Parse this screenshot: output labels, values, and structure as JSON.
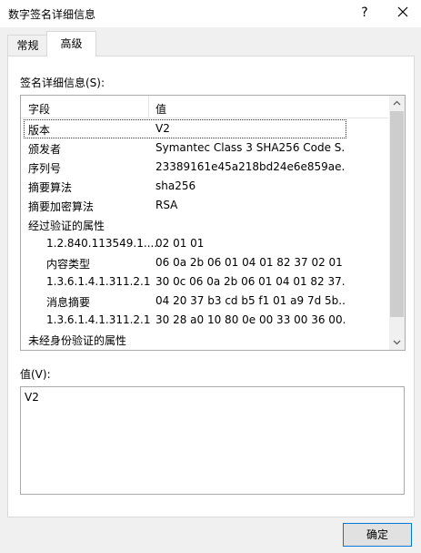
{
  "window": {
    "title": "数字签名详细信息",
    "help_label": "?"
  },
  "tabs": [
    {
      "label": "常规",
      "active": false
    },
    {
      "label": "高级",
      "active": true
    }
  ],
  "signature_details": {
    "label": "签名详细信息(S):",
    "columns": {
      "field": "字段",
      "value": "值"
    },
    "rows": [
      {
        "field": "版本",
        "value": "V2",
        "indent": 0,
        "selected": true
      },
      {
        "field": "颁发者",
        "value": "Symantec Class 3 SHA256 Code S...",
        "indent": 0
      },
      {
        "field": "序列号",
        "value": "23389161e45a218bd24e6e859ae...",
        "indent": 0
      },
      {
        "field": "摘要算法",
        "value": "sha256",
        "indent": 0
      },
      {
        "field": "摘要加密算法",
        "value": "RSA",
        "indent": 0
      },
      {
        "field": "经过验证的属性",
        "value": "",
        "indent": 0
      },
      {
        "field": "1.2.840.113549.1....",
        "value": "02 01 01",
        "indent": 1
      },
      {
        "field": "内容类型",
        "value": "06 0a 2b 06 01 04 01 82 37 02 01",
        "indent": 1
      },
      {
        "field": "1.3.6.1.4.1.311.2.1",
        "value": "30 0c 06 0a 2b 06 01 04 01 82 37...",
        "indent": 1
      },
      {
        "field": "消息摘要",
        "value": "04 20 37 b3 cd b5 f1 01 a9 7d 5b...",
        "indent": 1
      },
      {
        "field": "1.3.6.1.4.1.311.2.1",
        "value": "30 28 a0 10 80 0e 00 33 00 36 00...",
        "indent": 1
      },
      {
        "field": "未经身份验证的属性",
        "value": "",
        "indent": 0
      }
    ]
  },
  "value_panel": {
    "label": "值(V):",
    "text": "V2"
  },
  "ok_button": {
    "label": "确定"
  }
}
